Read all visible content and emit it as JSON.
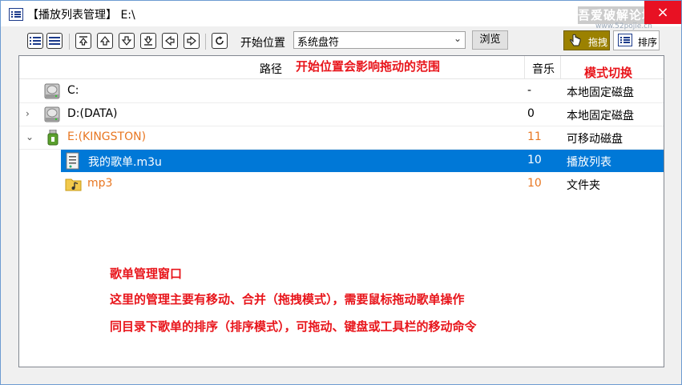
{
  "window": {
    "title": "【播放列表管理】 E:\\",
    "close_symbol": "×"
  },
  "watermark": {
    "text": "吾爱破解论坛",
    "sub": "www.52pojie.cn"
  },
  "toolbar": {
    "start_label": "开始位置",
    "start_select_value": "系统盘符",
    "browse_label": "浏览",
    "mode_drag_label": "拖拽",
    "mode_sort_label": "排序",
    "icons": [
      "list-view-icon",
      "detail-view-icon",
      "move-top-icon",
      "move-up-icon",
      "move-down-icon",
      "move-bottom-icon",
      "move-left-icon",
      "move-right-icon",
      "refresh-icon"
    ]
  },
  "columns": {
    "path": "路径",
    "music": "音乐"
  },
  "rows": [
    {
      "name": "C:",
      "count": "-",
      "type": "本地固定磁盘",
      "icon": "hard-drive-icon",
      "expander": ""
    },
    {
      "name": "D:(DATA)",
      "count": "0",
      "type": "本地固定磁盘",
      "icon": "hard-drive-icon",
      "expander": "›"
    },
    {
      "name": "E:(KINGSTON)",
      "count": "11",
      "type": "可移动磁盘",
      "icon": "usb-drive-icon",
      "expander": "⌄"
    },
    {
      "name": "我的歌单.m3u",
      "count": "10",
      "type": "播放列表",
      "icon": "playlist-file-icon",
      "expander": ""
    },
    {
      "name": "mp3",
      "count": "10",
      "type": "文件夹",
      "icon": "music-folder-icon",
      "expander": ""
    }
  ],
  "annotations": {
    "range": "开始位置会影响拖动的范围",
    "mode": "模式切换",
    "line1": "歌单管理窗口",
    "line2": "这里的管理主要有移动、合并（拖拽模式），需要鼠标拖动歌单操作",
    "line3": "同目录下歌单的排序（排序模式），可拖动、键盘或工具栏的移动命令"
  },
  "colors": {
    "selection": "#0078d7",
    "highlight_text": "#e87722",
    "annotation": "#e8151b",
    "mode_active": "#9b8100"
  }
}
